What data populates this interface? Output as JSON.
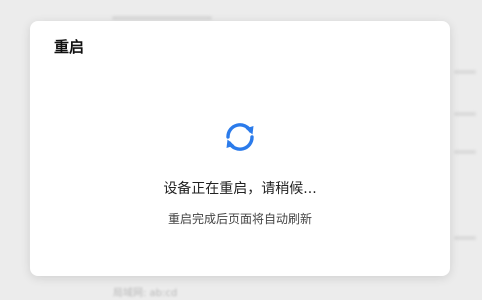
{
  "dialog": {
    "title": "重启",
    "status_main": "设备正在重启，请稍候...",
    "status_sub": "重启完成后页面将自动刷新",
    "icon": "refresh-icon",
    "accent_color": "#2B7BEB"
  },
  "background": {
    "bottom_label": "局域网: ab:cd"
  }
}
